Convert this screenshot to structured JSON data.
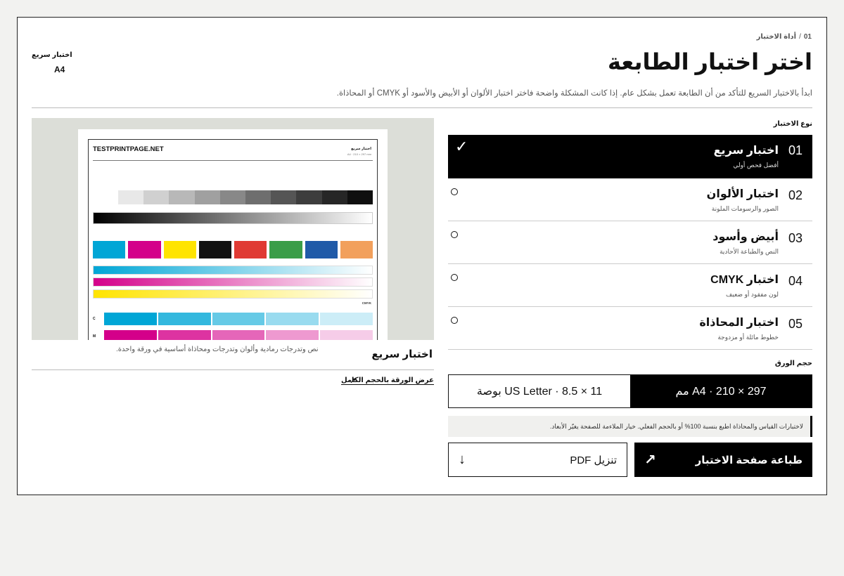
{
  "header": {
    "step": "01",
    "tool": "أداة الاختبار",
    "title": "اختر اختبار الطابعة",
    "description": "ابدأ بالاختبار السريع للتأكد من أن الطابعة تعمل بشكل عام. إذا كانت المشكلة واضحة فاختر اختبار الألوان أو الأبيض والأسود أو CMYK أو المحاذاة."
  },
  "summary": {
    "test": "اختبار سريع",
    "paper": "A4"
  },
  "test_type": {
    "label": "نوع الاختبار",
    "options": [
      {
        "num": "01",
        "name": "اختبار سريع",
        "sub": "أفضل فحص أولي",
        "selected": true
      },
      {
        "num": "02",
        "name": "اختبار الألوان",
        "sub": "الصور والرسومات الملونة",
        "selected": false
      },
      {
        "num": "03",
        "name": "أبيض وأسود",
        "sub": "النص والطباعة الأحادية",
        "selected": false
      },
      {
        "num": "04",
        "name": "اختبار CMYK",
        "sub": "لون مفقود أو ضعيف",
        "selected": false
      },
      {
        "num": "05",
        "name": "اختبار المحاذاة",
        "sub": "خطوط مائلة أو مزدوجة",
        "selected": false
      }
    ],
    "check_icon": "✓"
  },
  "paper": {
    "label": "حجم الورق",
    "a4": "A4 · 210 × 297 مم",
    "letter": "US Letter · 8.5 × 11 بوصة",
    "note": "لاختبارات القياس والمحاذاة اطبع بنسبة 100% أو بالحجم الفعلي. خيار الملاءمة للصفحة يغيّر الأبعاد."
  },
  "actions": {
    "print": "طباعة صفحة الاختبار",
    "print_icon": "↗",
    "download": "تنزيل PDF",
    "download_icon": "↓"
  },
  "preview": {
    "brand": "TESTPRINTPAGE.NET",
    "sheet_title": "اختبار سريع",
    "sheet_size": "A4 · 210 × 297 mm",
    "row_label_c": "C",
    "row_label_m": "M",
    "cmyk_label": "CMYK",
    "name": "اختبار سريع",
    "desc": "نص وتدرجات رمادية وألوان وتدرجات ومحاذاة أساسية في ورقة واحدة.",
    "view_full": "عرض الورقة بالحجم الكامل",
    "view_icon": "↗"
  },
  "colors": {
    "grays": [
      "#e8e8e8",
      "#d0d0d0",
      "#b8b8b8",
      "#a0a0a0",
      "#888888",
      "#6e6e6e",
      "#555555",
      "#3d3d3d",
      "#262626",
      "#0f0f0f"
    ],
    "swatches": [
      "#00a6d6",
      "#d4008a",
      "#ffe400",
      "#111111",
      "#e03a33",
      "#3a9d48",
      "#1f5aa8",
      "#f2a05c"
    ],
    "cyan": "#00a6d6",
    "magenta": "#d4008a",
    "yellow": "#ffe400"
  }
}
